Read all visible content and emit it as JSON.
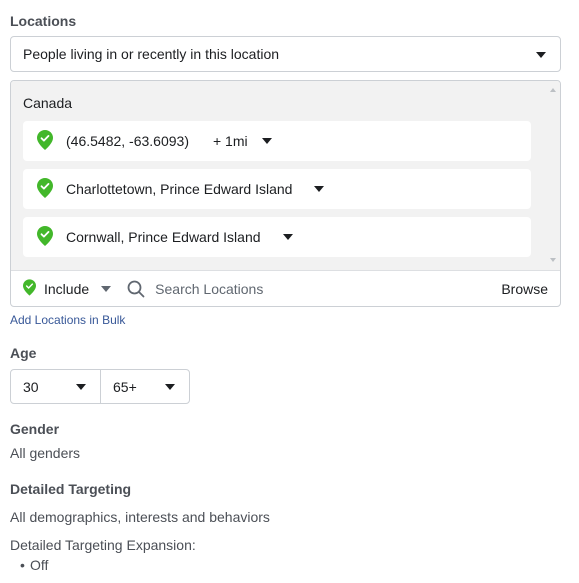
{
  "locations": {
    "title": "Locations",
    "mode_select": "People living in or recently in this location",
    "country": "Canada",
    "items": [
      {
        "label": "(46.5482, -63.6093)",
        "radius": "+ 1mi"
      },
      {
        "label": "Charlottetown, Prince Edward Island"
      },
      {
        "label": "Cornwall, Prince Edward Island"
      }
    ],
    "include_label": "Include",
    "search_placeholder": "Search Locations",
    "browse_label": "Browse",
    "bulk_link": "Add Locations in Bulk"
  },
  "age": {
    "title": "Age",
    "min": "30",
    "max": "65+"
  },
  "gender": {
    "title": "Gender",
    "value": "All genders"
  },
  "detailed_targeting": {
    "title": "Detailed Targeting",
    "value": "All demographics, interests and behaviors",
    "expansion_label": "Detailed Targeting Expansion:",
    "expansion_value": "Off"
  },
  "colors": {
    "pin_green": "#42b72a",
    "link_blue": "#385898",
    "list_background": "#f2f2f2"
  },
  "icons": {
    "pin": "map-pin-check-icon",
    "search": "search-icon",
    "dropdown": "caret-down-icon"
  }
}
